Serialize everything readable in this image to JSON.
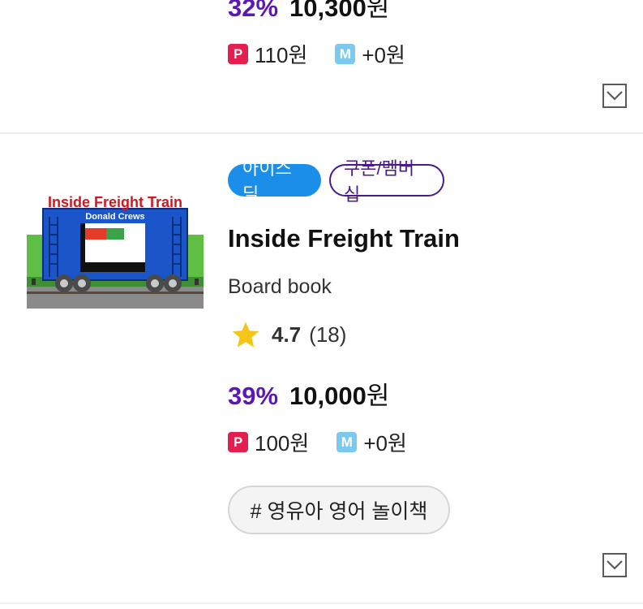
{
  "prev_item": {
    "discount": "32%",
    "price": "10,300",
    "currency": "원",
    "points": {
      "p_badge": "P",
      "p_amount": "110원",
      "m_badge": "M",
      "m_amount": "+0원"
    }
  },
  "item": {
    "tags": [
      "아이스딜",
      "쿠폰/멤버십"
    ],
    "cover": {
      "title": "Inside Freight Train",
      "author": "Donald Crews"
    },
    "title": "Inside Freight Train",
    "format": "Board book",
    "rating": {
      "value": "4.7",
      "count": "(18)"
    },
    "discount": "39%",
    "price": "10,000",
    "currency": "원",
    "points": {
      "p_badge": "P",
      "p_amount": "100원",
      "m_badge": "M",
      "m_amount": "+0원"
    },
    "hashtag": "# 영유아 영어 놀이책"
  },
  "colors": {
    "discount": "#5b18b5",
    "tag_solid": "#1a8ee8",
    "tag_outline": "#4a1a8a",
    "point_badge": "#e21f4f",
    "member_badge": "#7cc9f0",
    "star": "#f5c518"
  },
  "icons": {
    "expand": "chevron-down-icon",
    "rating": "star-icon"
  }
}
